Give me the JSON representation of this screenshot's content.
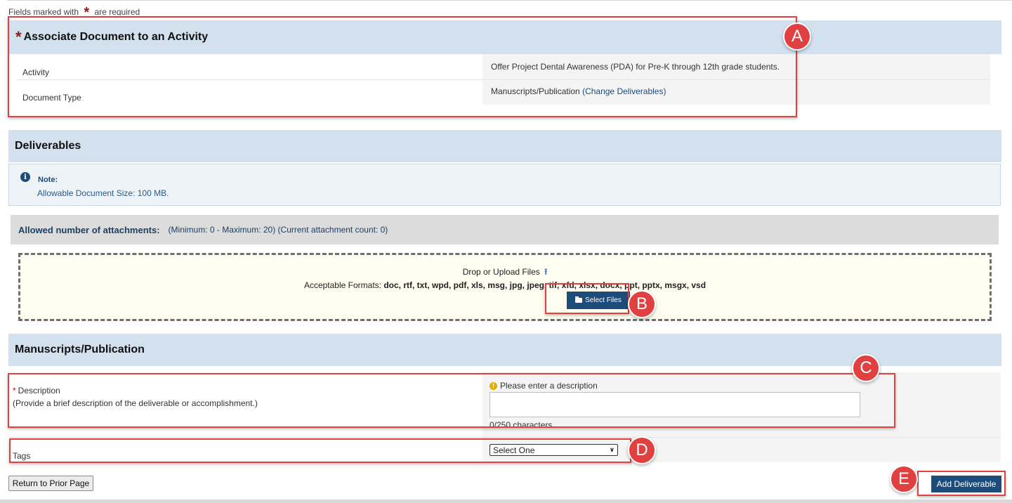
{
  "header": {
    "required_note_prefix": "Fields marked with",
    "required_note_suffix": "are required"
  },
  "associate_section": {
    "title": "Associate Document to an Activity",
    "rows": [
      {
        "label": "Activity",
        "value": "Offer Project Dental Awareness (PDA) for Pre-K through 12th grade students."
      },
      {
        "label": "Document Type",
        "value": "Manuscripts/Publication",
        "link": "(Change Deliverables)"
      }
    ]
  },
  "deliverables_section": {
    "title": "Deliverables",
    "note_title": "Note:",
    "note_text": "Allowable Document Size: 100 MB.",
    "attachments_title": "Allowed number of attachments:",
    "attachments_info": "(Minimum: 0 - Maximum: 20) (Current attachment count: 0)",
    "drop_title": "Drop or Upload Files",
    "formats_label": "Acceptable Formats:",
    "formats": "doc, rtf, txt, wpd, pdf, xls, msg, jpg, jpeg, tif, xfd, xlsx, docx, ppt, pptx, msgx, vsd",
    "select_files_label": "Select Files"
  },
  "manuscripts_section": {
    "title": "Manuscripts/Publication",
    "description_label": "Description",
    "description_help": "(Provide a brief description of the deliverable or accomplishment.)",
    "description_warning": "Please enter a description",
    "description_value": "",
    "char_count": "0/250 characters",
    "tags_label": "Tags",
    "tags_selected": "Select One"
  },
  "footer": {
    "return_label": "Return to Prior Page",
    "add_label": "Add Deliverable"
  },
  "callouts": [
    "A",
    "B",
    "C",
    "D",
    "E"
  ],
  "colors": {
    "section_header": "#d3e1ee",
    "primary_button": "#1d4b7a",
    "callout": "#e0403f",
    "dropzone_bg": "#fefdf0"
  }
}
